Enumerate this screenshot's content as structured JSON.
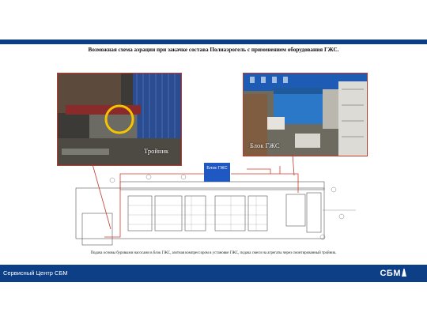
{
  "header": {
    "title": "Возможная схема аэрации при закачке состава Полиаэрогель с применением оборудования ГЖС."
  },
  "photos": {
    "left_label": "Тройник",
    "right_label": "Блок ГЖС"
  },
  "scheme": {
    "block_label": "Блок ГЖС"
  },
  "caption": "Подача основы буровыми насосами в блок ГЖС, азотная компрессором в установке ГЖС, подача смеси на агрегаты через смонтированный тройник.",
  "footer": {
    "left_text": "Сервисный Центр СБМ",
    "logo_text": "СБМ"
  },
  "colors": {
    "brand_blue": "#0d3f86",
    "frame_red": "#c0392b",
    "block_blue": "#1f57c3"
  }
}
